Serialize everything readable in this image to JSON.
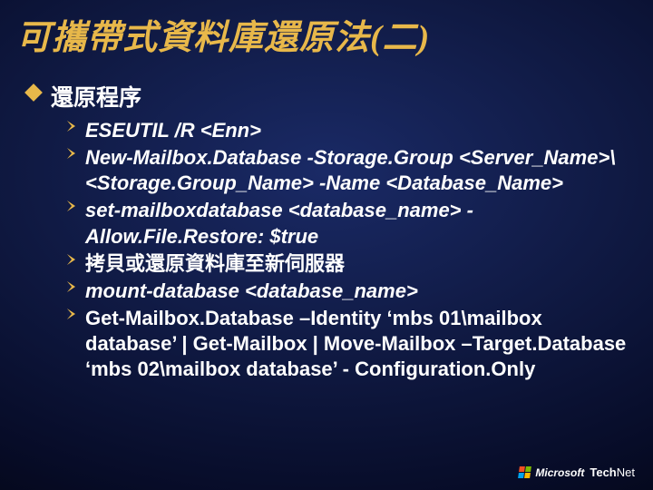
{
  "title": "可攜帶式資料庫還原法(二)",
  "section_heading": "還原程序",
  "steps": [
    "ESEUTIL /R <Enn>",
    "New-Mailbox.Database -Storage.Group <Server_Name>\\<Storage.Group_Name> -Name <Database_Name>",
    "set-mailboxdatabase <database_name> - Allow.File.Restore: $true",
    "拷貝或還原資料庫至新伺服器",
    "mount-database <database_name>",
    "Get-Mailbox.Database –Identity ‘mbs 01\\mailbox database’ | Get-Mailbox | Move-Mailbox –Target.Database ‘mbs 02\\mailbox database’ - Configuration.Only"
  ],
  "footer": {
    "brand": "Microsoft",
    "product_a": "Tech",
    "product_b": "Net"
  }
}
